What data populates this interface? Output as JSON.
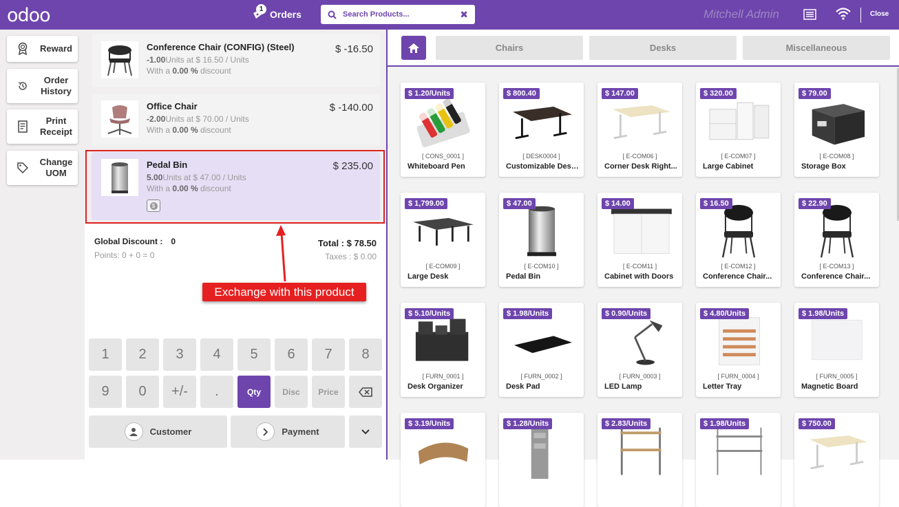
{
  "header": {
    "logo": "odoo",
    "orders_label": "Orders",
    "orders_count": "1",
    "search_placeholder": "Search Products...",
    "user": "Mitchell Admin",
    "close_label": "Close"
  },
  "control_buttons": [
    {
      "label": "Reward",
      "icon": "ribbon-icon"
    },
    {
      "label": "Order History",
      "icon": "history-icon"
    },
    {
      "label": "Print Receipt",
      "icon": "receipt-icon"
    },
    {
      "label": "Change UOM",
      "icon": "tag-icon"
    }
  ],
  "orderlines": [
    {
      "name": "Conference Chair (CONFIG) (Steel)",
      "qty": "-1.00",
      "unit_text": "Units at $ 16.50 / Units",
      "discount_prefix": "With a ",
      "discount": "0.00 %",
      "discount_suffix": " discount",
      "price": "$ -16.50"
    },
    {
      "name": "Office Chair",
      "qty": "-2.00",
      "unit_text": "Units at $ 70.00 / Units",
      "discount_prefix": "With a ",
      "discount": "0.00 %",
      "discount_suffix": " discount",
      "price": "$ -140.00"
    },
    {
      "name": "Pedal Bin",
      "qty": "5.00",
      "unit_text": "Units at $ 47.00 / Units",
      "discount_prefix": "With a ",
      "discount": "0.00 %",
      "discount_suffix": " discount",
      "price": "$ 235.00",
      "selected": true
    }
  ],
  "summary": {
    "global_discount_label": "Global Discount :",
    "global_discount_value": "0",
    "points": "Points: 0 + 0 = 0",
    "total": "Total : $ 78.50",
    "taxes": "Taxes : $ 0.00"
  },
  "annotation": "Exchange with this product",
  "numpad": {
    "row1": [
      "1",
      "2",
      "3",
      "4",
      "5",
      "6",
      "7",
      "8"
    ],
    "row2": [
      "9",
      "0",
      "+/-",
      "."
    ],
    "modes": [
      "Qty",
      "Disc",
      "Price"
    ],
    "customer": "Customer",
    "payment": "Payment"
  },
  "categories": [
    "Chairs",
    "Desks",
    "Miscellaneous"
  ],
  "products": [
    {
      "price": "$ 1.20/Units",
      "ref": "[ CONS_0001 ]",
      "name": "Whiteboard Pen",
      "img": "pens"
    },
    {
      "price": "$ 800.40",
      "ref": "[ DESK0004 ]",
      "name": "Customizable Desk...",
      "img": "desk-dark"
    },
    {
      "price": "$ 147.00",
      "ref": "[ E-COM06 ]",
      "name": "Corner Desk Right...",
      "img": "desk-light"
    },
    {
      "price": "$ 320.00",
      "ref": "[ E-COM07 ]",
      "name": "Large Cabinet",
      "img": "cabinet"
    },
    {
      "price": "$ 79.00",
      "ref": "[ E-COM08 ]",
      "name": "Storage Box",
      "img": "box"
    },
    {
      "price": "$ 1,799.00",
      "ref": "[ E-COM09 ]",
      "name": "Large Desk",
      "img": "desk-large"
    },
    {
      "price": "$ 47.00",
      "ref": "[ E-COM10 ]",
      "name": "Pedal Bin",
      "img": "bin"
    },
    {
      "price": "$ 14.00",
      "ref": "[ E-COM11 ]",
      "name": "Cabinet with Doors",
      "img": "cab-doors"
    },
    {
      "price": "$ 16.50",
      "ref": "[ E-COM12 ]",
      "name": "Conference Chair...",
      "img": "chair"
    },
    {
      "price": "$ 22.90",
      "ref": "[ E-COM13 ]",
      "name": "Conference Chair...",
      "img": "chair"
    },
    {
      "price": "$ 5.10/Units",
      "ref": "[ FURN_0001 ]",
      "name": "Desk Organizer",
      "img": "organizer"
    },
    {
      "price": "$ 1.98/Units",
      "ref": "[ FURN_0002 ]",
      "name": "Desk Pad",
      "img": "pad"
    },
    {
      "price": "$ 0.90/Units",
      "ref": "[ FURN_0003 ]",
      "name": "LED Lamp",
      "img": "lamp"
    },
    {
      "price": "$ 4.80/Units",
      "ref": "[ FURN_0004 ]",
      "name": "Letter Tray",
      "img": "tray"
    },
    {
      "price": "$ 1.98/Units",
      "ref": "[ FURN_0005 ]",
      "name": "Magnetic Board",
      "img": "board"
    },
    {
      "price": "$ 3.19/Units",
      "ref": "",
      "name": "",
      "img": "stand"
    },
    {
      "price": "$ 1.28/Units",
      "ref": "",
      "name": "",
      "img": "rack"
    },
    {
      "price": "$ 2.83/Units",
      "ref": "",
      "name": "",
      "img": "shelf"
    },
    {
      "price": "$ 1.98/Units",
      "ref": "",
      "name": "",
      "img": "shelf2"
    },
    {
      "price": "$ 750.00",
      "ref": "",
      "name": "",
      "img": "desk-light"
    }
  ]
}
